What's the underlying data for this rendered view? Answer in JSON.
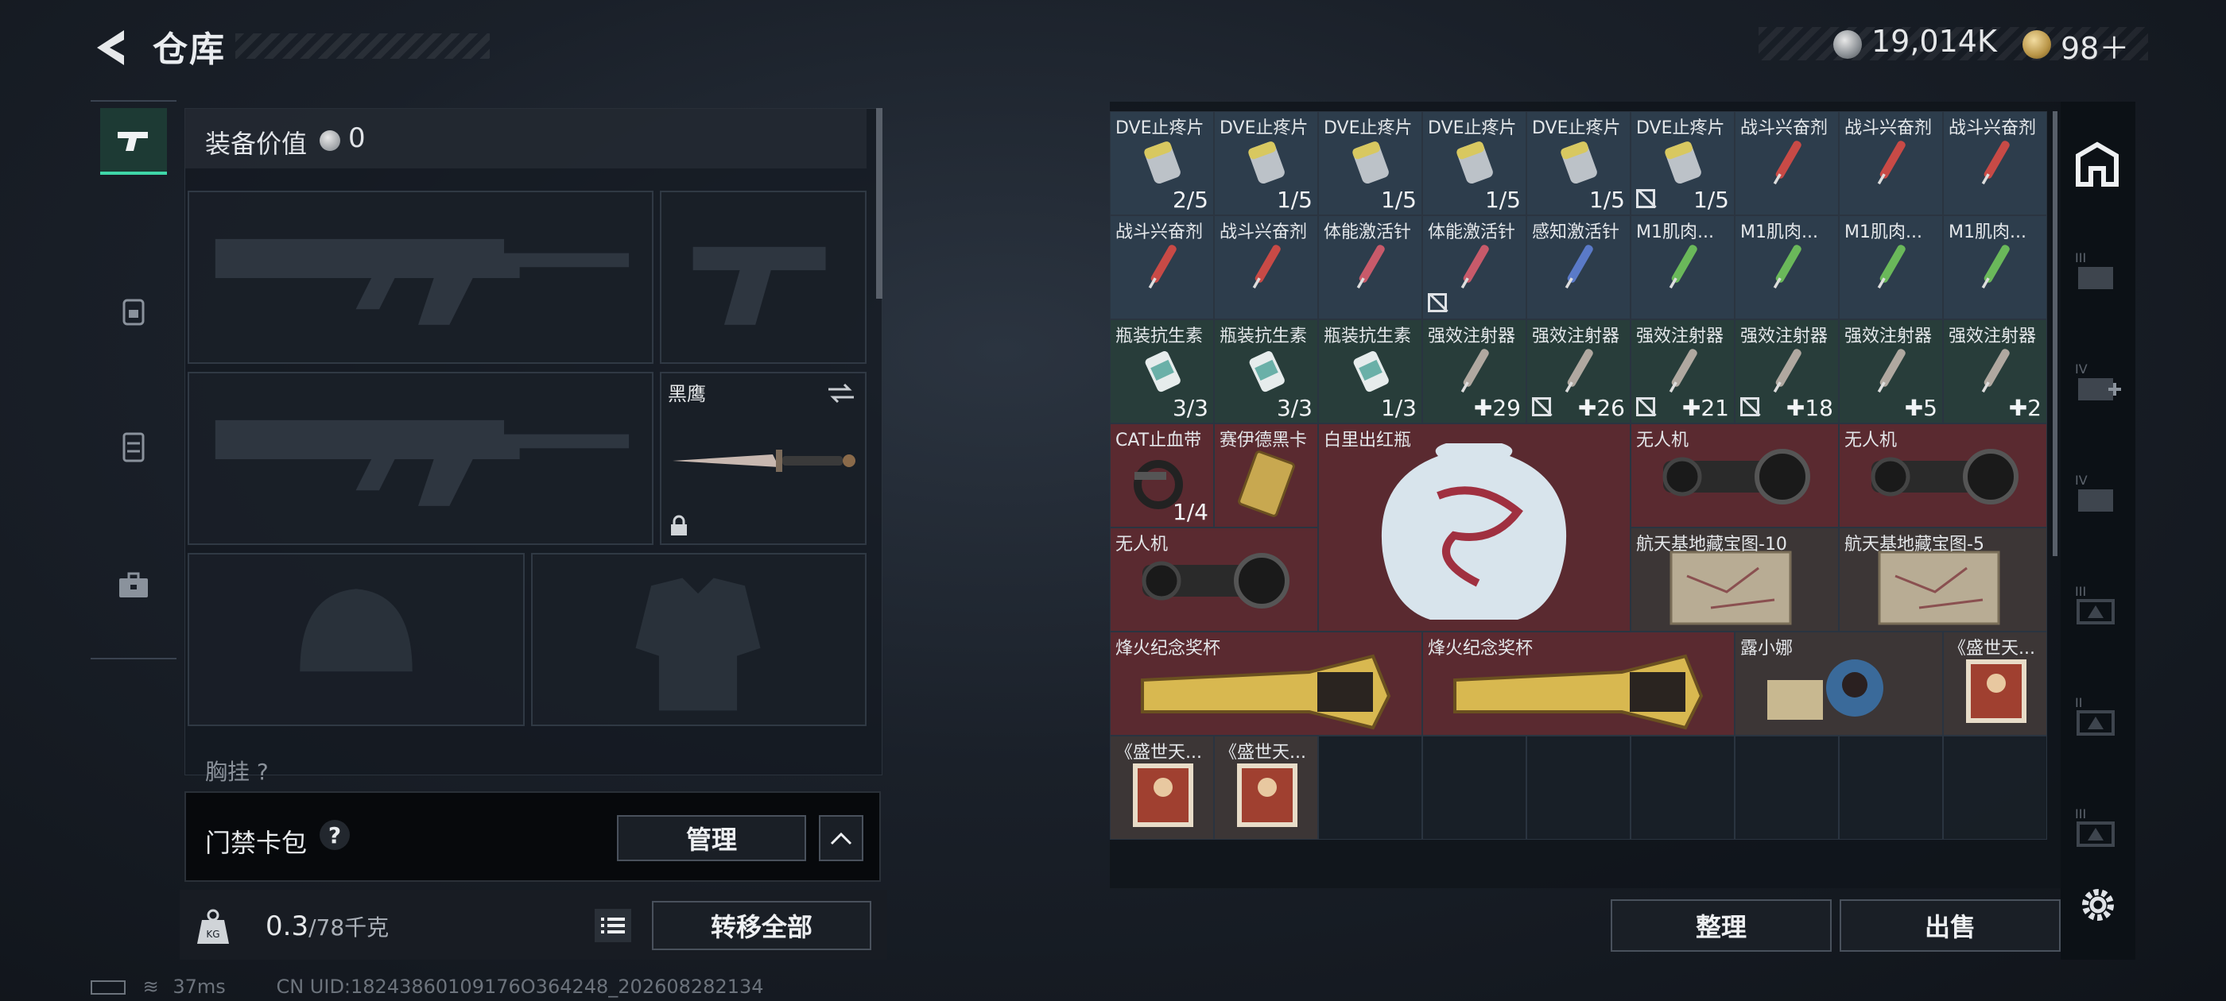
{
  "header": {
    "title": "仓库",
    "currency_silver": "19,014K",
    "currency_gold": "98＋"
  },
  "equipment": {
    "value_label": "装备价值",
    "value": "0",
    "knife_slot_name": "黑鹰",
    "chest_label": "胸挂 ?"
  },
  "card_pack": {
    "label": "门禁卡包",
    "help": "?",
    "manage_label": "管理"
  },
  "weight": {
    "current": "0.3",
    "max": "/78千克",
    "transfer_all_label": "转移全部"
  },
  "status_bar": {
    "ping": "37ms",
    "uid": "CN UID:18243860109176O364248_202608282134"
  },
  "storage": {
    "row1": [
      {
        "name": "DVE止疼片",
        "count": "2/5",
        "kind": "pill",
        "color": "blue",
        "nodrop": false
      },
      {
        "name": "DVE止疼片",
        "count": "1/5",
        "kind": "pill",
        "color": "blue",
        "nodrop": false
      },
      {
        "name": "DVE止疼片",
        "count": "1/5",
        "kind": "pill",
        "color": "blue",
        "nodrop": false
      },
      {
        "name": "DVE止疼片",
        "count": "1/5",
        "kind": "pill",
        "color": "blue",
        "nodrop": false
      },
      {
        "name": "DVE止疼片",
        "count": "1/5",
        "kind": "pill",
        "color": "blue",
        "nodrop": false
      },
      {
        "name": "DVE止疼片",
        "count": "1/5",
        "kind": "pill",
        "color": "blue",
        "nodrop": true
      },
      {
        "name": "战斗兴奋剂",
        "count": "",
        "kind": "syringe-red",
        "color": "blue",
        "nodrop": false
      },
      {
        "name": "战斗兴奋剂",
        "count": "",
        "kind": "syringe-red",
        "color": "blue",
        "nodrop": false
      },
      {
        "name": "战斗兴奋剂",
        "count": "",
        "kind": "syringe-red",
        "color": "blue",
        "nodrop": false
      }
    ],
    "row2": [
      {
        "name": "战斗兴奋剂",
        "count": "",
        "kind": "syringe-red",
        "color": "blue",
        "nodrop": false
      },
      {
        "name": "战斗兴奋剂",
        "count": "",
        "kind": "syringe-red",
        "color": "blue",
        "nodrop": false
      },
      {
        "name": "体能激活针",
        "count": "",
        "kind": "syringe-pink",
        "color": "blue",
        "nodrop": false
      },
      {
        "name": "体能激活针",
        "count": "",
        "kind": "syringe-pink",
        "color": "blue",
        "nodrop": true
      },
      {
        "name": "感知激活针",
        "count": "",
        "kind": "syringe-blue",
        "color": "blue",
        "nodrop": false
      },
      {
        "name": "M1肌肉...",
        "count": "",
        "kind": "syringe-green",
        "color": "blue",
        "nodrop": false
      },
      {
        "name": "M1肌肉...",
        "count": "",
        "kind": "syringe-green",
        "color": "blue",
        "nodrop": false
      },
      {
        "name": "M1肌肉...",
        "count": "",
        "kind": "syringe-green",
        "color": "blue",
        "nodrop": false
      },
      {
        "name": "M1肌肉...",
        "count": "",
        "kind": "syringe-green",
        "color": "blue",
        "nodrop": false
      }
    ],
    "row3": [
      {
        "name": "瓶装抗生素",
        "count": "3/3",
        "kind": "bottle",
        "color": "green",
        "nodrop": false
      },
      {
        "name": "瓶装抗生素",
        "count": "3/3",
        "kind": "bottle",
        "color": "green",
        "nodrop": false
      },
      {
        "name": "瓶装抗生素",
        "count": "1/3",
        "kind": "bottle",
        "color": "green",
        "nodrop": false
      },
      {
        "name": "强效注射器",
        "count": "✚29",
        "kind": "syringe-white",
        "color": "green",
        "nodrop": false
      },
      {
        "name": "强效注射器",
        "count": "✚26",
        "kind": "syringe-white",
        "color": "green",
        "nodrop": true
      },
      {
        "name": "强效注射器",
        "count": "✚21",
        "kind": "syringe-white",
        "color": "green",
        "nodrop": true
      },
      {
        "name": "强效注射器",
        "count": "✚18",
        "kind": "syringe-white",
        "color": "green",
        "nodrop": true
      },
      {
        "name": "强效注射器",
        "count": "✚5",
        "kind": "syringe-white",
        "color": "green",
        "nodrop": false
      },
      {
        "name": "强效注射器",
        "count": "✚2",
        "kind": "syringe-white",
        "color": "green",
        "nodrop": false
      }
    ],
    "tourniquet": {
      "name": "CAT止血带",
      "count": "1/4"
    },
    "keycard": {
      "name": "赛伊德黑卡"
    },
    "vase": {
      "name": "白里出红瓶"
    },
    "drone": {
      "name": "无人机"
    },
    "map": {
      "name_a": "航天基地藏宝图-10",
      "name_b": "航天基地藏宝图-5"
    },
    "trophy": {
      "name": "烽火纪念奖杯"
    },
    "doll": {
      "name": "露小娜"
    },
    "book": {
      "name": "《盛世天..."
    }
  },
  "actions": {
    "sort_label": "整理",
    "sell_label": "出售"
  }
}
